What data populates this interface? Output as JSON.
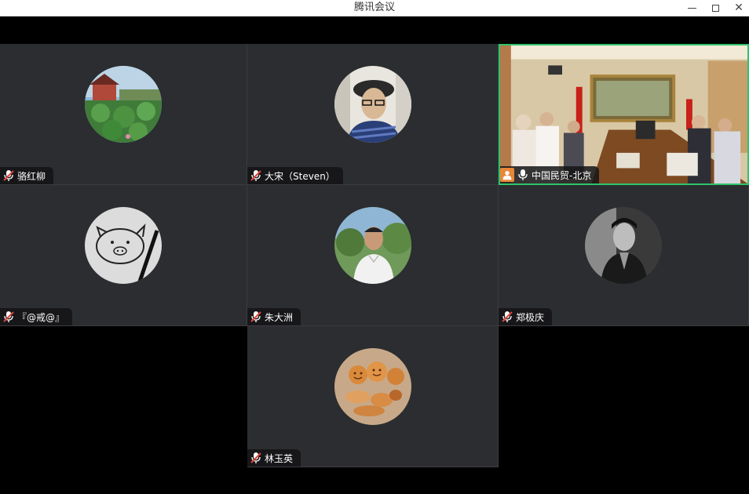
{
  "window": {
    "title": "腾讯会议"
  },
  "participants": [
    {
      "name": "骆红柳",
      "mic": "muted",
      "avatar": "lotus-pavilion-photo"
    },
    {
      "name": "大宋（Steven）",
      "mic": "muted",
      "avatar": "man-with-cap-photo"
    },
    {
      "name": "中国民贸-北京",
      "mic": "on",
      "avatar": "meeting-room-video",
      "active_speaker": true
    },
    {
      "name": "『@戒@』",
      "mic": "muted",
      "avatar": "pig-sketch-photo"
    },
    {
      "name": "朱大洲",
      "mic": "muted",
      "avatar": "man-outdoors-photo"
    },
    {
      "name": "郑极庆",
      "mic": "muted",
      "avatar": "black-white-portrait"
    },
    {
      "name": "林玉英",
      "mic": "muted",
      "avatar": "smiley-cookies-photo"
    }
  ],
  "colors": {
    "tile_bg": "#2b2d30",
    "active_border": "#2ec46b",
    "muted_icon": "#e0453a",
    "user_badge": "#e8873a"
  }
}
